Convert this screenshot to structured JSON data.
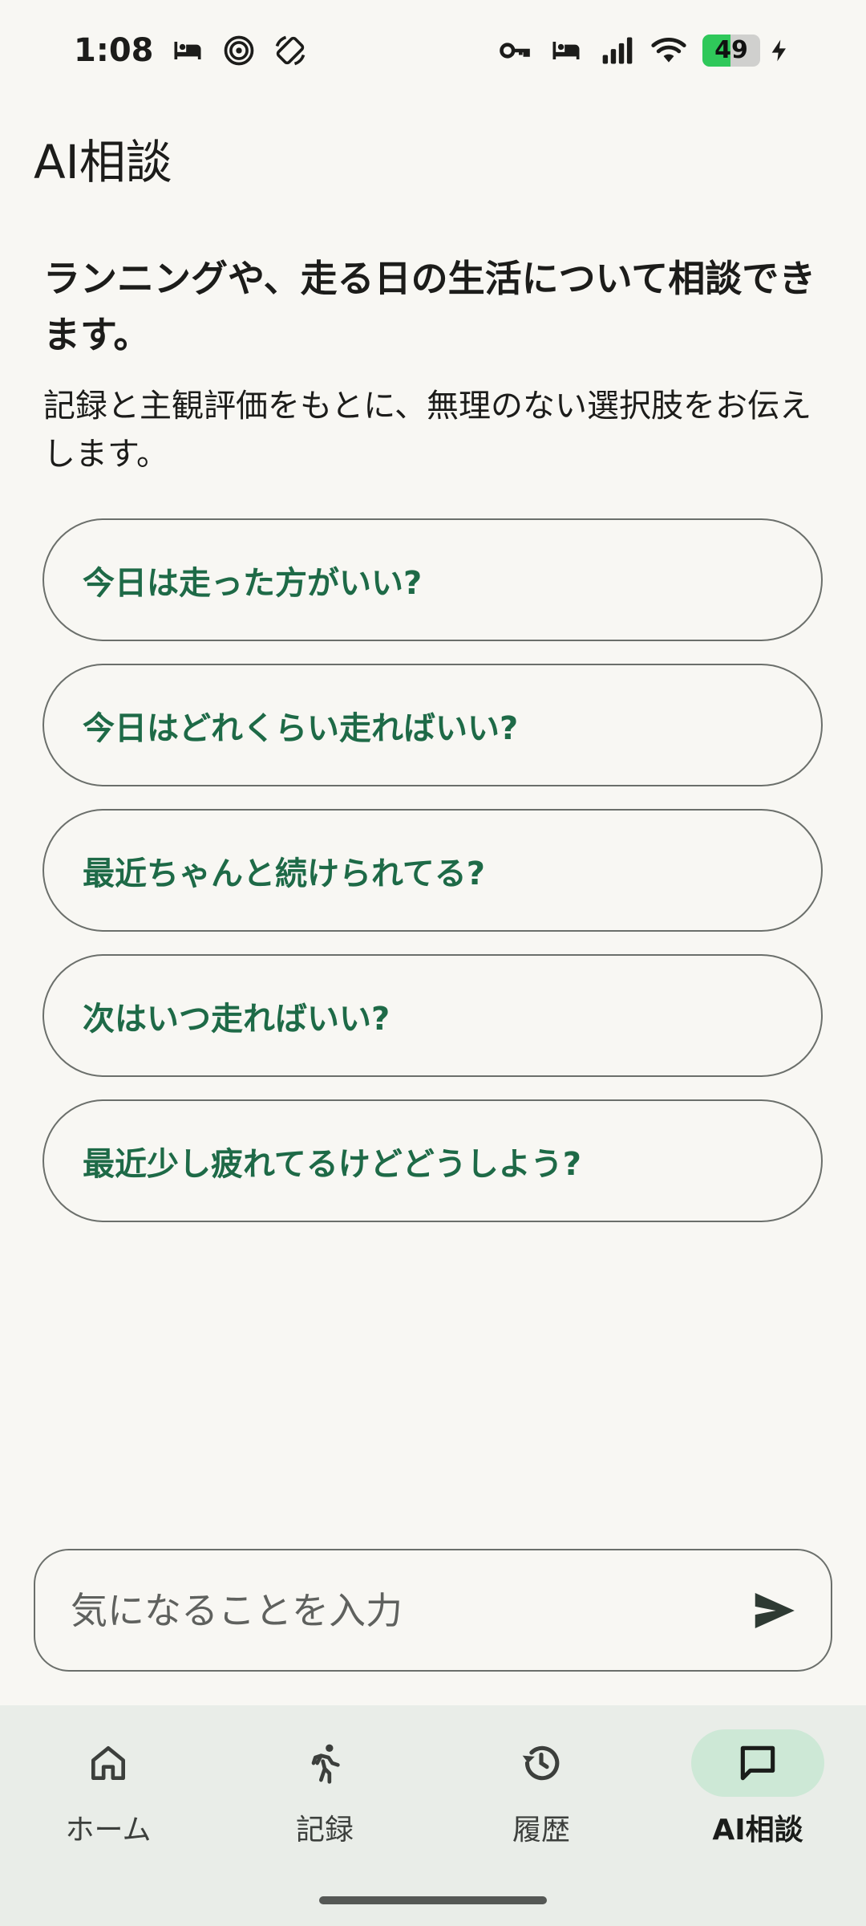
{
  "status_bar": {
    "time": "1:08",
    "battery_level": "49",
    "battery_fraction": 0.49,
    "battery_color": "#2fc85a",
    "icons": [
      "bed-icon",
      "spiral-icon",
      "rotate-icon",
      "key-icon",
      "bed-icon",
      "signal-icon",
      "wifi-icon",
      "charging-icon"
    ]
  },
  "page": {
    "title": "AI相談"
  },
  "intro": {
    "heading": "ランニングや、走る日の生活について相談できます。",
    "body": "記録と主観評価をもとに、無理のない選択肢をお伝えします。"
  },
  "suggestions": [
    "今日は走った方がいい?",
    "今日はどれくらい走ればいい?",
    "最近ちゃんと続けられてる?",
    "次はいつ走ればいい?",
    "最近少し疲れてるけどどうしよう?"
  ],
  "input": {
    "placeholder": "気になることを入力",
    "value": ""
  },
  "nav": {
    "items": [
      {
        "label": "ホーム",
        "icon": "home-icon",
        "active": false
      },
      {
        "label": "記録",
        "icon": "runner-icon",
        "active": false
      },
      {
        "label": "履歴",
        "icon": "history-icon",
        "active": false
      },
      {
        "label": "AI相談",
        "icon": "chat-icon",
        "active": true
      }
    ]
  },
  "colors": {
    "accent": "#1e6a47",
    "active_pill": "#cde8d6",
    "nav_background": "#e9ede8",
    "page_background": "#f8f7f3"
  }
}
